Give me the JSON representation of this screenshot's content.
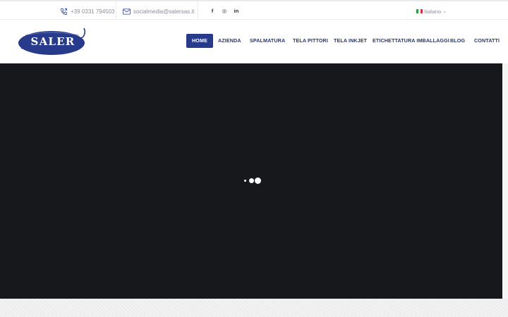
{
  "topbar": {
    "phone": "+39 0331 794503",
    "email": "socialmedia@salersas.it",
    "social": [
      {
        "icon": "facebook-icon",
        "glyph": "f"
      },
      {
        "icon": "instagram-icon",
        "glyph": "◎"
      },
      {
        "icon": "linkedin-icon",
        "glyph": "in"
      }
    ],
    "language": "Italiano"
  },
  "logo": {
    "text": "SALER"
  },
  "nav": {
    "items": [
      {
        "label": "HOME",
        "active": true
      },
      {
        "label": "AZIENDA"
      },
      {
        "label": "SPALMATURA"
      },
      {
        "label": "TELA PITTORI"
      },
      {
        "label": "TELA INKJET"
      },
      {
        "label": "ETICHETTATURA IMBALLAGGI"
      },
      {
        "label": "BLOG"
      },
      {
        "label": "CONTATTI"
      }
    ]
  },
  "colors": {
    "brand": "#283a8a",
    "hero_bg": "#17181b",
    "topbar_text": "#8a8f99"
  }
}
